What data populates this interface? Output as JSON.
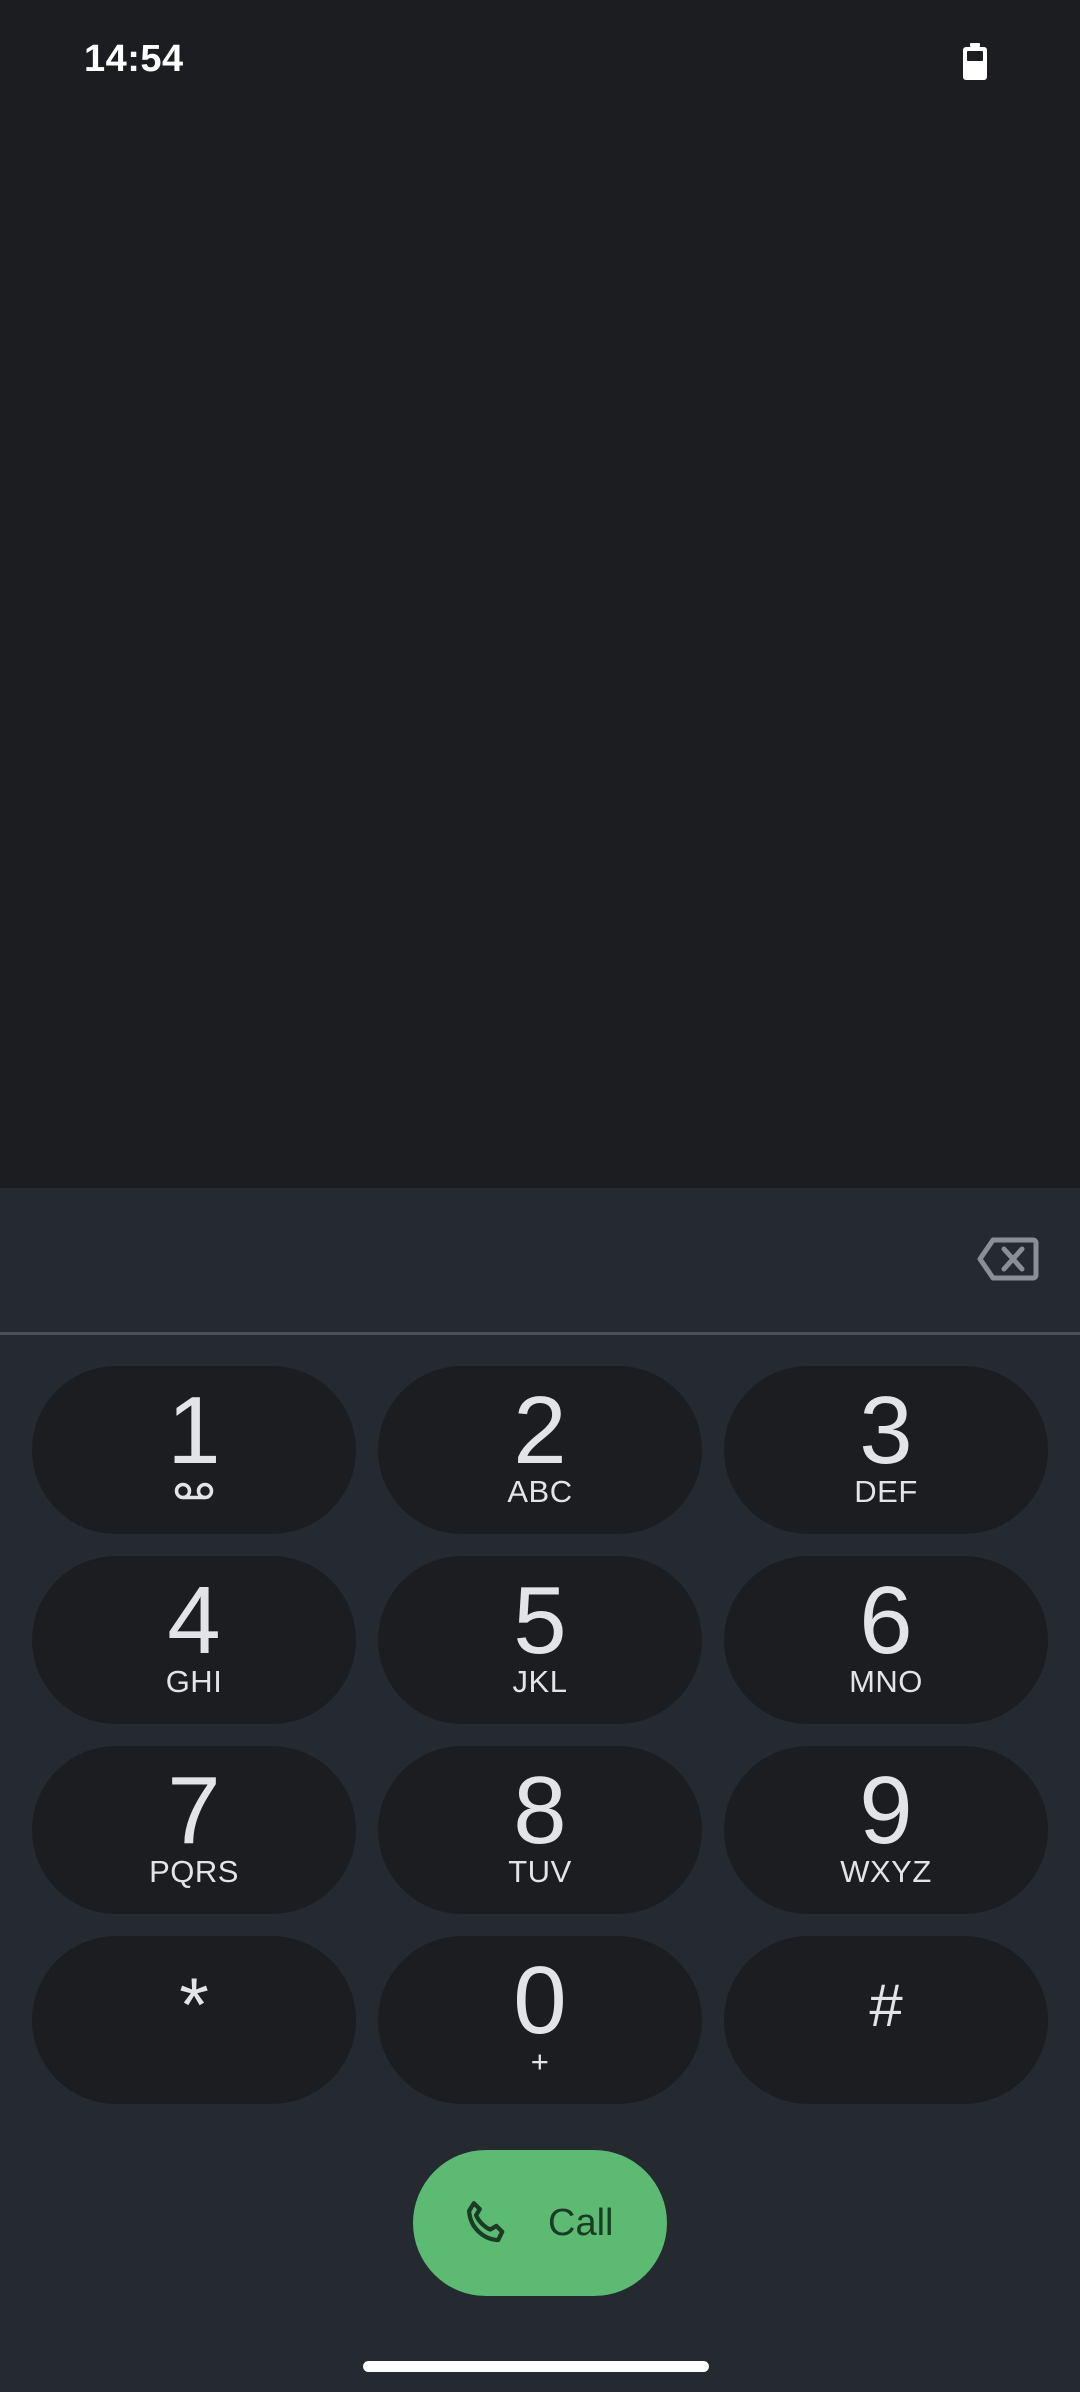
{
  "status_bar": {
    "time": "14:54",
    "battery_icon": "battery-icon"
  },
  "dialer": {
    "digits": "",
    "backspace_icon": "backspace-icon"
  },
  "keypad": {
    "keys": [
      {
        "digit": "1",
        "letters": "",
        "icon": "voicemail-icon"
      },
      {
        "digit": "2",
        "letters": "ABC"
      },
      {
        "digit": "3",
        "letters": "DEF"
      },
      {
        "digit": "4",
        "letters": "GHI"
      },
      {
        "digit": "5",
        "letters": "JKL"
      },
      {
        "digit": "6",
        "letters": "MNO"
      },
      {
        "digit": "7",
        "letters": "PQRS"
      },
      {
        "digit": "8",
        "letters": "TUV"
      },
      {
        "digit": "9",
        "letters": "WXYZ"
      },
      {
        "digit": "*",
        "letters": ""
      },
      {
        "digit": "0",
        "letters": "+"
      },
      {
        "digit": "#",
        "letters": ""
      }
    ]
  },
  "call_button": {
    "label": "Call",
    "icon": "phone-icon"
  },
  "colors": {
    "background": "#1b1d21",
    "sheet": "#252a31",
    "key": "#1b1d21",
    "call_green": "#5dba73",
    "text": "#e3e4e8"
  }
}
